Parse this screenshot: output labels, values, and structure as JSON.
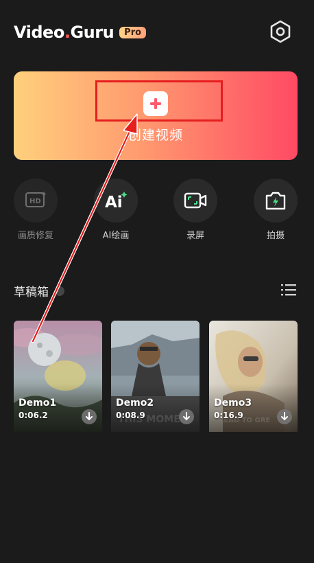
{
  "header": {
    "logo_text_a": "Video",
    "logo_dot": ".",
    "logo_text_b": "Guru",
    "pro_badge": "Pro",
    "settings_icon": "hexagon-settings-icon"
  },
  "create": {
    "label": "创建视频",
    "plus_icon": "plus-icon",
    "gradient": [
      "#ffd07d",
      "#ff9a6f",
      "#ff4a64"
    ]
  },
  "tools": [
    {
      "label": "画质修复",
      "icon": "hd-icon"
    },
    {
      "label": "AI绘画",
      "icon": "ai-sparkle-icon"
    },
    {
      "label": "录屏",
      "icon": "screen-record-icon"
    },
    {
      "label": "拍摄",
      "icon": "camera-icon"
    }
  ],
  "drafts": {
    "title": "草稿箱",
    "items": [
      {
        "title": "Demo1",
        "duration": "0:06.2"
      },
      {
        "title": "Demo2",
        "duration": "0:08.9"
      },
      {
        "title": "Demo3",
        "duration": "0:16.9"
      }
    ]
  },
  "annotation": {
    "highlight_color": "#e51e1e",
    "arrow_color": "#e51e1e"
  }
}
